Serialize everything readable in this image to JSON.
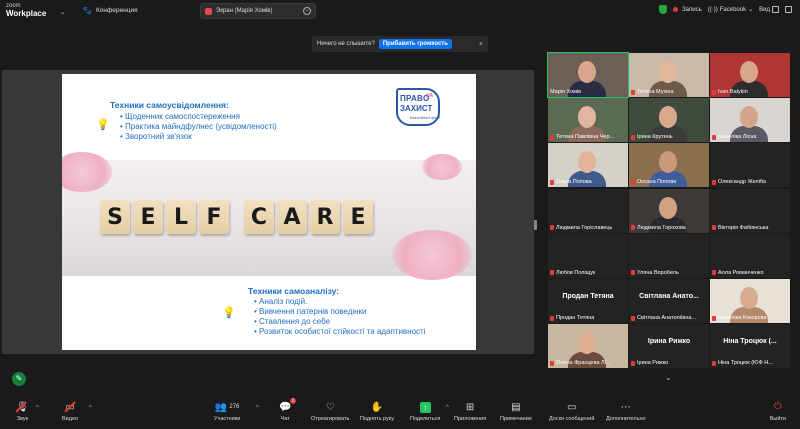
{
  "app": {
    "brand_line1": "zoom",
    "brand_line2": "Workplace",
    "meeting_title": "Конференция"
  },
  "share_pill": {
    "label": "Экран (Марія Хомів)"
  },
  "top_right": {
    "record": "Запись",
    "facebook": "Facebook",
    "view": "Вид"
  },
  "notification": {
    "text": "Ничего не слышите?",
    "button": "Прибавить громкость",
    "close": "×"
  },
  "slide": {
    "top_heading": "Техники самоусвідомлення:",
    "top_items": [
      "Щоденник самоспостереження",
      "Практика майндфулнес (усвідомленості)",
      "Зворотний зв'язок"
    ],
    "logo_line1": "ПРАВО",
    "logo_small": "НА",
    "logo_line2": "ЗАХИСТ",
    "logo_sub": "Благодійний фонд",
    "tiles": [
      "S",
      "E",
      "L",
      "F",
      "C",
      "A",
      "R",
      "E"
    ],
    "bottom_heading": "Техники самоаналізу:",
    "bottom_items": [
      "Аналіз подій.",
      "Вивчення патернів поведінки",
      "Ставлення до себе",
      "Розвиток особистої стійкості та адаптивності"
    ]
  },
  "gallery": {
    "participants": [
      {
        "name": "Марія Хомів",
        "muted": false,
        "video": true,
        "bg": "#6b5f58",
        "skin": "#d9a58b",
        "shirt": "#2b2b46"
      },
      {
        "name": "Тетяна Мухіна",
        "muted": true,
        "video": true,
        "bg": "#c9b9a8",
        "skin": "#e1b79a",
        "shirt": "#6d5a4a"
      },
      {
        "name": "Ivan Balykin",
        "muted": true,
        "video": true,
        "bg": "#b03535",
        "skin": "#d6a58a",
        "shirt": "#2d2d2d"
      },
      {
        "name": "Тетяна Павлівна Чер...",
        "muted": true,
        "video": true,
        "bg": "#5b6a52",
        "skin": "#e0b6a0",
        "shirt": "#8a6a5a"
      },
      {
        "name": "Ірина Крутень",
        "muted": true,
        "video": true,
        "bg": "#3e4a3e",
        "skin": "#d7a98a",
        "shirt": "#3b3b3b"
      },
      {
        "name": "Анжеліка Лісна",
        "muted": true,
        "video": true,
        "bg": "#d8d4d0",
        "skin": "#d3a58c",
        "shirt": "#5a5a66"
      },
      {
        "name": "Ольга Попова",
        "muted": true,
        "video": true,
        "bg": "#d6d1c8",
        "skin": "#e2b59b",
        "shirt": "#3d5a8a"
      },
      {
        "name": "Оксана Попова",
        "muted": true,
        "video": true,
        "bg": "#8a6e4e",
        "skin": "#c89a7a",
        "shirt": "#3f5e9a"
      },
      {
        "name": "Олександр Желіба",
        "muted": true,
        "video": false
      },
      {
        "name": "Людмила Горіславець",
        "muted": true,
        "video": false
      },
      {
        "name": "Людмила Горохова",
        "muted": true,
        "video": true,
        "bg": "#3d3a38",
        "skin": "#d2a082",
        "shirt": "#2a2a2a"
      },
      {
        "name": "Вікторія Фабіянська",
        "muted": true,
        "video": false
      },
      {
        "name": "Любов Поліщук",
        "muted": true,
        "video": false
      },
      {
        "name": "Уляна Воробель",
        "muted": true,
        "video": false
      },
      {
        "name": "Алла Романченко",
        "muted": true,
        "video": false
      },
      {
        "name": "Продан Тетяна",
        "muted": true,
        "video": false,
        "big": "Продан Тетяна"
      },
      {
        "name": "Світлана Анатоліївна...",
        "muted": true,
        "video": false,
        "big": "Світлана Анато..."
      },
      {
        "name": "Анжеліка Кокорєва",
        "muted": true,
        "video": true,
        "bg": "#e7e1d8",
        "skin": "#d8ab8e",
        "shirt": "#b58a6a"
      },
      {
        "name": "Олена Францева Лі...",
        "muted": true,
        "video": true,
        "bg": "#c9b8a0",
        "skin": "#e0b092",
        "shirt": "#6a4a3a"
      },
      {
        "name": "Ірина Рижко",
        "muted": true,
        "video": false,
        "big": "Ірина Рижко"
      },
      {
        "name": "Ніна Троцюк (ЮФ Н...",
        "muted": true,
        "video": false,
        "big": "Ніна Троцюк (..."
      }
    ]
  },
  "toolbar": {
    "audio": "Звук",
    "video": "Видео",
    "participants": "Участники",
    "participants_count": "276",
    "chat": "Чат",
    "chat_badge": "1",
    "react": "Отреагировать",
    "raise": "Поднять руку",
    "share": "Поделиться",
    "apps": "Приложения",
    "notes": "Примечания",
    "board": "Доски сообщений",
    "more": "Дополнительно",
    "leave": "Выйти"
  }
}
